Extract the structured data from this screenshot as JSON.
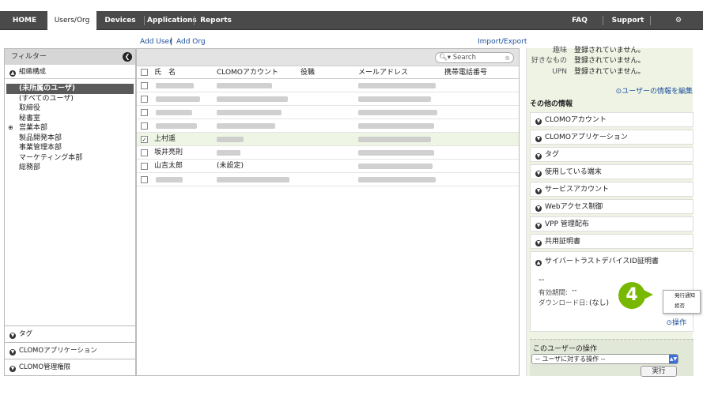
{
  "nav": {
    "tabs": [
      "HOME",
      "Users/Org",
      "Devices",
      "Applications",
      "Reports"
    ],
    "right": [
      "FAQ",
      "Support",
      "Settings"
    ]
  },
  "sublinks": {
    "add_user": "Add User",
    "add_org": "Add Org",
    "import_export": "Import/Export"
  },
  "left": {
    "filter": "フィルター",
    "org_section": "組織構成",
    "tree": [
      "(未所属のユーザ)",
      "(すべてのユーザ)",
      "取締役",
      "秘書室",
      "営業本部",
      "製品開発本部",
      "事業管理本部",
      "マーケティング本部",
      "総務部"
    ],
    "bottom": [
      "タグ",
      "CLOMOアプリケーション",
      "CLOMO管理権限"
    ]
  },
  "center": {
    "search_placeholder": "Search",
    "columns": [
      "氏　名",
      "CLOMOアカウント",
      "役職",
      "メールアドレス",
      "携帯電話番号"
    ],
    "rows": [
      {
        "name": "",
        "account": "",
        "checked": false
      },
      {
        "name": "",
        "account": "",
        "checked": false
      },
      {
        "name": "",
        "account": "",
        "checked": false
      },
      {
        "name": "",
        "account": "",
        "checked": false
      },
      {
        "name": "上村遥",
        "account": "",
        "checked": true
      },
      {
        "name": "坂井亮則",
        "account": "",
        "checked": false
      },
      {
        "name": "山吉太郎",
        "account": "(未設定)",
        "checked": false
      },
      {
        "name": "",
        "account": "",
        "checked": false
      }
    ]
  },
  "right": {
    "kv": [
      {
        "k": "趣味",
        "v": "登録されていません。"
      },
      {
        "k": "好きなもの",
        "v": "登録されていません。"
      },
      {
        "k": "UPN",
        "v": "登録されていません。"
      }
    ],
    "edit_link": "ユーザーの情報を編集",
    "other_title": "その他の情報",
    "accordions": [
      "CLOMOアカウント",
      "CLOMOアプリケーション",
      "タグ",
      "使用している端末",
      "サービスアカウント",
      "Webアクセス制御",
      "VPP 管理配布",
      "共用証明書",
      "サイバートラストデバイスID証明書"
    ],
    "cert": {
      "dash": "--",
      "expiry_label": "有効期間:",
      "expiry_value": "--",
      "download_label": "ダウンロード日:",
      "download_value": "(なし)",
      "op_link": "操作"
    },
    "ops": {
      "title": "このユーザーの操作",
      "select": "-- ユーザに対する操作 --",
      "exec": "実行"
    }
  },
  "callout": {
    "number": "4",
    "menu": [
      "発行通知",
      "拒否"
    ]
  }
}
